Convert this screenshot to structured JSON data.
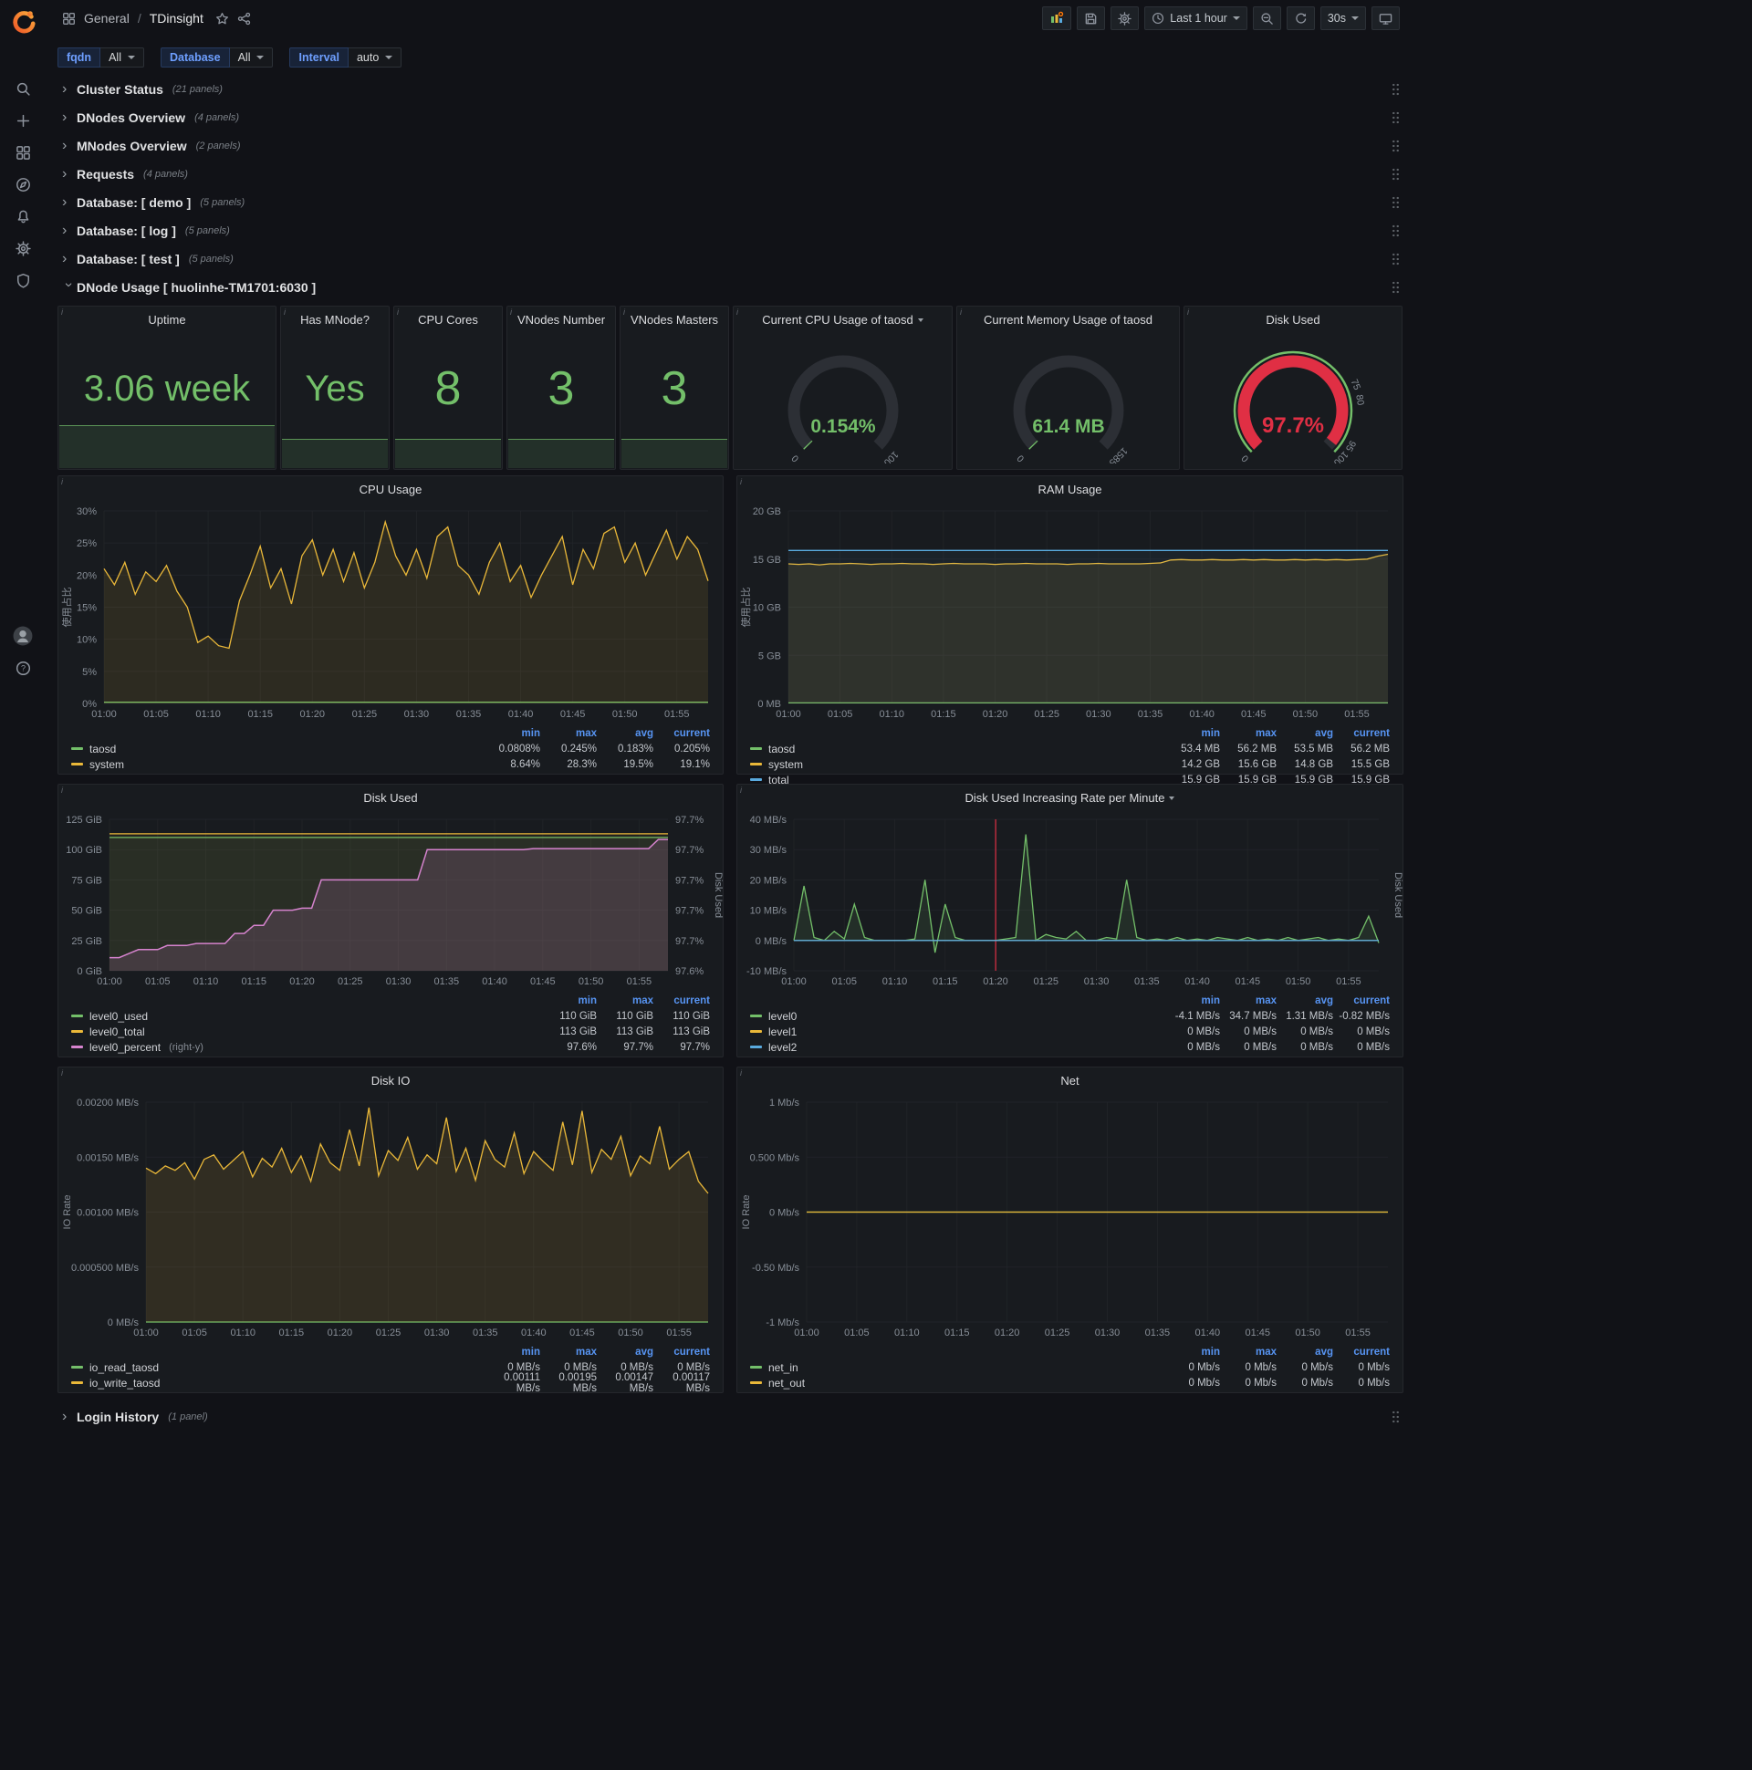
{
  "colors": {
    "green": "#73bf69",
    "yellow": "#eab839",
    "blue": "#59aade",
    "pink": "#d683ce",
    "red": "#e02f44"
  },
  "topbar": {
    "breadcrumb": {
      "section": "General",
      "separator": "/",
      "title": "TDinsight"
    },
    "time_range": "Last 1 hour",
    "refresh": "30s"
  },
  "variables": [
    {
      "label": "fqdn",
      "value": "All"
    },
    {
      "label": "Database",
      "value": "All"
    },
    {
      "label": "Interval",
      "value": "auto"
    }
  ],
  "collapsed_rows": [
    {
      "title": "Cluster Status",
      "count": "(21 panels)"
    },
    {
      "title": "DNodes Overview",
      "count": "(4 panels)"
    },
    {
      "title": "MNodes Overview",
      "count": "(2 panels)"
    },
    {
      "title": "Requests",
      "count": "(4 panels)"
    },
    {
      "title": "Database: [ demo ]",
      "count": "(5 panels)"
    },
    {
      "title": "Database: [ log ]",
      "count": "(5 panels)"
    },
    {
      "title": "Database: [ test ]",
      "count": "(5 panels)"
    }
  ],
  "expanded_row": {
    "title": "DNode Usage [ huolinhe-TM1701:6030 ]"
  },
  "bottom_row": {
    "title": "Login History",
    "count": "(1 panel)"
  },
  "stats": [
    {
      "title": "Uptime",
      "value": "3.06 week"
    },
    {
      "title": "Has MNode?",
      "value": "Yes"
    },
    {
      "title": "CPU Cores",
      "value": "8"
    },
    {
      "title": "VNodes Number",
      "value": "3"
    },
    {
      "title": "VNodes Masters",
      "value": "3"
    }
  ],
  "gauges": [
    {
      "title": "Current CPU Usage of taosd",
      "value": "0.154%",
      "fraction": 0.0025,
      "value_color": "#73bf69",
      "arc_color": "#73bf69",
      "min_label": "0",
      "max_label": "100"
    },
    {
      "title": "Current Memory Usage of taosd",
      "value": "61.4 MB",
      "fraction": 0.004,
      "value_color": "#73bf69",
      "arc_color": "#73bf69",
      "min_label": "0",
      "max_label": "15854"
    },
    {
      "title": "Disk Used",
      "value": "97.7%",
      "fraction": 0.977,
      "value_color": "#e02f44",
      "arc_color": "#e02f44",
      "min_label": "0",
      "threshold_labels": [
        75,
        80,
        95,
        100
      ],
      "outline_color": "#73bf69"
    }
  ],
  "chart_data": [
    {
      "id": "cpu_usage",
      "type": "line",
      "title": "CPU Usage",
      "ylabel": "使用占比",
      "y_min": 0,
      "y_max": 30,
      "y_ticks": [
        {
          "v": 0,
          "label": "0%"
        },
        {
          "v": 5,
          "label": "5%"
        },
        {
          "v": 10,
          "label": "10%"
        },
        {
          "v": 15,
          "label": "15%"
        },
        {
          "v": 20,
          "label": "20%"
        },
        {
          "v": 25,
          "label": "25%"
        },
        {
          "v": 30,
          "label": "30%"
        }
      ],
      "x_minutes": 58,
      "x_tick_every": 5,
      "x_ticks": [
        "01:00",
        "01:05",
        "01:10",
        "01:15",
        "01:20",
        "01:25",
        "01:30",
        "01:35",
        "01:40",
        "01:45",
        "01:50",
        "01:55"
      ],
      "series": [
        {
          "name": "taosd",
          "color": "#73bf69",
          "flat": 0.2,
          "fill": 0.1
        },
        {
          "name": "system",
          "color": "#eab839",
          "fill": 0.1,
          "values": [
            21,
            18.5,
            22,
            17,
            20.5,
            19,
            21.5,
            17.5,
            15,
            9.5,
            10.5,
            9,
            8.6,
            16,
            20,
            24.5,
            18,
            21,
            15.5,
            23,
            25.5,
            20,
            24,
            19,
            23.5,
            18,
            22,
            28.3,
            23,
            20,
            24,
            19.5,
            26,
            27.5,
            21.5,
            20,
            17,
            22,
            25,
            19,
            21.5,
            16.5,
            20,
            23,
            26,
            18.5,
            24,
            21,
            26.5,
            27.5,
            22,
            25,
            20,
            23.5,
            27,
            22.5,
            26,
            24,
            19.1
          ]
        }
      ],
      "legend": {
        "columns": [
          "min",
          "max",
          "avg",
          "current"
        ],
        "rows": [
          {
            "name": "taosd",
            "color": "#73bf69",
            "values": [
              "0.0808%",
              "0.245%",
              "0.183%",
              "0.205%"
            ]
          },
          {
            "name": "system",
            "color": "#eab839",
            "values": [
              "8.64%",
              "28.3%",
              "19.5%",
              "19.1%"
            ]
          }
        ]
      }
    },
    {
      "id": "ram_usage",
      "type": "line",
      "title": "RAM Usage",
      "ylabel": "使用占比",
      "y_min": 0,
      "y_max": 20,
      "y_ticks": [
        {
          "v": 0,
          "label": "0 MB"
        },
        {
          "v": 5,
          "label": "5 GB"
        },
        {
          "v": 10,
          "label": "10 GB"
        },
        {
          "v": 15,
          "label": "15 GB"
        },
        {
          "v": 20,
          "label": "20 GB"
        }
      ],
      "x_minutes": 58,
      "x_tick_every": 5,
      "x_ticks": [
        "01:00",
        "01:05",
        "01:10",
        "01:15",
        "01:20",
        "01:25",
        "01:30",
        "01:35",
        "01:40",
        "01:45",
        "01:50",
        "01:55"
      ],
      "series": [
        {
          "name": "taosd",
          "color": "#73bf69",
          "flat": 0.055,
          "fill": 0.1
        },
        {
          "name": "system",
          "color": "#eab839",
          "fill": 0.1,
          "values": [
            14.5,
            14.45,
            14.5,
            14.4,
            14.5,
            14.5,
            14.55,
            14.5,
            14.45,
            14.5,
            14.5,
            14.55,
            14.5,
            14.5,
            14.45,
            14.5,
            14.55,
            14.5,
            14.5,
            14.5,
            14.45,
            14.5,
            14.5,
            14.55,
            14.5,
            14.5,
            14.5,
            14.45,
            14.5,
            14.5,
            14.55,
            14.5,
            14.5,
            14.5,
            14.5,
            14.55,
            14.6,
            14.9,
            14.95,
            14.9,
            14.9,
            14.95,
            14.9,
            14.9,
            14.95,
            14.9,
            14.95,
            14.9,
            14.9,
            14.95,
            14.9,
            14.95,
            14.9,
            14.95,
            14.9,
            14.95,
            15.0,
            15.3,
            15.5
          ]
        },
        {
          "name": "total",
          "color": "#59aade",
          "flat": 15.9,
          "fill": 0.06
        }
      ],
      "legend": {
        "columns": [
          "min",
          "max",
          "avg",
          "current"
        ],
        "rows": [
          {
            "name": "taosd",
            "color": "#73bf69",
            "values": [
              "53.4 MB",
              "56.2 MB",
              "53.5 MB",
              "56.2 MB"
            ]
          },
          {
            "name": "system",
            "color": "#eab839",
            "values": [
              "14.2 GB",
              "15.6 GB",
              "14.8 GB",
              "15.5 GB"
            ]
          },
          {
            "name": "total",
            "color": "#59aade",
            "values": [
              "15.9 GB",
              "15.9 GB",
              "15.9 GB",
              "15.9 GB"
            ]
          }
        ]
      }
    },
    {
      "id": "disk_used",
      "type": "line",
      "title": "Disk Used",
      "y_min": 0,
      "y_max": 125,
      "y_ticks": [
        {
          "v": 0,
          "label": "0 GiB"
        },
        {
          "v": 25,
          "label": "25 GiB"
        },
        {
          "v": 50,
          "label": "50 GiB"
        },
        {
          "v": 75,
          "label": "75 GiB"
        },
        {
          "v": 100,
          "label": "100 GiB"
        },
        {
          "v": 125,
          "label": "125 GiB"
        }
      ],
      "right_min": 97.575,
      "right_max": 97.725,
      "right_label": "Disk Used",
      "right_ticks": [
        {
          "v": 97.575,
          "label": "97.6%"
        },
        {
          "v": 97.605,
          "label": "97.7%"
        },
        {
          "v": 97.635,
          "label": "97.7%"
        },
        {
          "v": 97.665,
          "label": "97.7%"
        },
        {
          "v": 97.695,
          "label": "97.7%"
        },
        {
          "v": 97.725,
          "label": "97.7%"
        }
      ],
      "x_minutes": 58,
      "x_tick_every": 5,
      "x_ticks": [
        "01:00",
        "01:05",
        "01:10",
        "01:15",
        "01:20",
        "01:25",
        "01:30",
        "01:35",
        "01:40",
        "01:45",
        "01:50",
        "01:55"
      ],
      "series": [
        {
          "name": "level0_used",
          "color": "#73bf69",
          "flat": 110,
          "fill": 0.08
        },
        {
          "name": "level0_total",
          "color": "#eab839",
          "flat": 113,
          "fill": 0.05
        },
        {
          "name": "level0_percent",
          "color": "#d683ce",
          "axis": "right",
          "fill": 0.16,
          "width": 1.5,
          "values": [
            97.588,
            97.588,
            97.592,
            97.596,
            97.596,
            97.596,
            97.6,
            97.6,
            97.6,
            97.602,
            97.602,
            97.602,
            97.602,
            97.612,
            97.612,
            97.62,
            97.62,
            97.635,
            97.635,
            97.635,
            97.637,
            97.637,
            97.665,
            97.665,
            97.665,
            97.665,
            97.665,
            97.665,
            97.665,
            97.665,
            97.665,
            97.665,
            97.665,
            97.695,
            97.695,
            97.695,
            97.695,
            97.695,
            97.695,
            97.695,
            97.695,
            97.695,
            97.695,
            97.695,
            97.696,
            97.696,
            97.696,
            97.696,
            97.696,
            97.696,
            97.696,
            97.696,
            97.696,
            97.696,
            97.696,
            97.696,
            97.696,
            97.705,
            97.705
          ]
        }
      ],
      "legend": {
        "columns": [
          "min",
          "max",
          "current"
        ],
        "rows": [
          {
            "name": "level0_used",
            "color": "#73bf69",
            "values": [
              "110 GiB",
              "110 GiB",
              "110 GiB"
            ]
          },
          {
            "name": "level0_total",
            "color": "#eab839",
            "values": [
              "113 GiB",
              "113 GiB",
              "113 GiB"
            ]
          },
          {
            "name": "level0_percent",
            "suffix": "(right-y)",
            "color": "#d683ce",
            "values": [
              "97.6%",
              "97.7%",
              "97.7%"
            ]
          }
        ]
      }
    },
    {
      "id": "disk_rate",
      "type": "line",
      "title": "Disk Used Increasing Rate per Minute",
      "y_min": -10,
      "y_max": 40,
      "y_ticks": [
        {
          "v": -10,
          "label": "-10 MB/s"
        },
        {
          "v": 0,
          "label": "0 MB/s"
        },
        {
          "v": 10,
          "label": "10 MB/s"
        },
        {
          "v": 20,
          "label": "20 MB/s"
        },
        {
          "v": 30,
          "label": "30 MB/s"
        },
        {
          "v": 40,
          "label": "40 MB/s"
        }
      ],
      "right_label": "Disk Used",
      "annotation_f": 0.345,
      "x_minutes": 58,
      "x_tick_every": 5,
      "x_ticks": [
        "01:00",
        "01:05",
        "01:10",
        "01:15",
        "01:20",
        "01:25",
        "01:30",
        "01:35",
        "01:40",
        "01:45",
        "01:50",
        "01:55"
      ],
      "series": [
        {
          "name": "level0",
          "color": "#73bf69",
          "fill": 0.12,
          "values": [
            0,
            18,
            1,
            0,
            3,
            0.5,
            12,
            1,
            0,
            0,
            0,
            0,
            0.5,
            20,
            -4,
            12,
            1,
            0,
            0,
            0,
            0,
            0.5,
            1,
            35,
            0,
            2,
            1,
            0.5,
            3,
            0,
            0,
            1,
            0.5,
            20,
            1,
            0,
            0.5,
            0,
            1,
            0,
            0.5,
            0,
            1,
            0.5,
            0,
            1,
            0,
            0.5,
            0,
            1,
            0,
            0.5,
            1,
            0,
            0.5,
            0,
            1,
            8,
            -0.8
          ]
        },
        {
          "name": "level1",
          "color": "#eab839",
          "flat": 0
        },
        {
          "name": "level2",
          "color": "#59aade",
          "flat": 0
        }
      ],
      "legend": {
        "columns": [
          "min",
          "max",
          "avg",
          "current"
        ],
        "rows": [
          {
            "name": "level0",
            "color": "#73bf69",
            "values": [
              "-4.1 MB/s",
              "34.7 MB/s",
              "1.31 MB/s",
              "-0.82 MB/s"
            ]
          },
          {
            "name": "level1",
            "color": "#eab839",
            "values": [
              "0 MB/s",
              "0 MB/s",
              "0 MB/s",
              "0 MB/s"
            ]
          },
          {
            "name": "level2",
            "color": "#59aade",
            "values": [
              "0 MB/s",
              "0 MB/s",
              "0 MB/s",
              "0 MB/s"
            ]
          }
        ]
      }
    },
    {
      "id": "disk_io",
      "type": "line",
      "title": "Disk IO",
      "ylabel": "IO Rate",
      "y_min": 0,
      "y_max": 0.002,
      "y_ticks": [
        {
          "v": 0,
          "label": "0 MB/s"
        },
        {
          "v": 0.0005,
          "label": "0.000500 MB/s"
        },
        {
          "v": 0.001,
          "label": "0.00100 MB/s"
        },
        {
          "v": 0.0015,
          "label": "0.00150 MB/s"
        },
        {
          "v": 0.002,
          "label": "0.00200 MB/s"
        }
      ],
      "x_minutes": 58,
      "x_tick_every": 5,
      "x_ticks": [
        "01:00",
        "01:05",
        "01:10",
        "01:15",
        "01:20",
        "01:25",
        "01:30",
        "01:35",
        "01:40",
        "01:45",
        "01:50",
        "01:55"
      ],
      "series": [
        {
          "name": "io_read_taosd",
          "color": "#73bf69",
          "flat": 0,
          "fill": 0.1
        },
        {
          "name": "io_write_taosd",
          "color": "#eab839",
          "fill": 0.12,
          "values": [
            0.0014,
            0.00135,
            0.00142,
            0.00138,
            0.00145,
            0.0013,
            0.00148,
            0.00152,
            0.00139,
            0.00147,
            0.00155,
            0.00132,
            0.00149,
            0.00141,
            0.00158,
            0.00136,
            0.00151,
            0.00128,
            0.00162,
            0.00145,
            0.00138,
            0.00175,
            0.00142,
            0.00195,
            0.00133,
            0.00156,
            0.00147,
            0.00168,
            0.00139,
            0.00152,
            0.00144,
            0.00186,
            0.00137,
            0.00158,
            0.00129,
            0.00165,
            0.00148,
            0.00141,
            0.00172,
            0.00135,
            0.00155,
            0.00146,
            0.00138,
            0.00182,
            0.00143,
            0.00192,
            0.00136,
            0.00157,
            0.00148,
            0.00169,
            0.00133,
            0.00151,
            0.00144,
            0.00178,
            0.00139,
            0.00148,
            0.00155,
            0.00128,
            0.00117
          ]
        }
      ],
      "legend": {
        "columns": [
          "min",
          "max",
          "avg",
          "current"
        ],
        "rows": [
          {
            "name": "io_read_taosd",
            "color": "#73bf69",
            "values": [
              "0 MB/s",
              "0 MB/s",
              "0 MB/s",
              "0 MB/s"
            ]
          },
          {
            "name": "io_write_taosd",
            "color": "#eab839",
            "values": [
              "0.00111 MB/s",
              "0.00195 MB/s",
              "0.00147 MB/s",
              "0.00117 MB/s"
            ]
          }
        ]
      }
    },
    {
      "id": "net",
      "type": "line",
      "title": "Net",
      "ylabel": "IO Rate",
      "y_min": -1,
      "y_max": 1,
      "y_ticks": [
        {
          "v": -1,
          "label": "-1 Mb/s"
        },
        {
          "v": -0.5,
          "label": "-0.50 Mb/s"
        },
        {
          "v": 0,
          "label": "0 Mb/s"
        },
        {
          "v": 0.5,
          "label": "0.500 Mb/s"
        },
        {
          "v": 1,
          "label": "1 Mb/s"
        }
      ],
      "x_minutes": 58,
      "x_tick_every": 5,
      "x_ticks": [
        "01:00",
        "01:05",
        "01:10",
        "01:15",
        "01:20",
        "01:25",
        "01:30",
        "01:35",
        "01:40",
        "01:45",
        "01:50",
        "01:55"
      ],
      "series": [
        {
          "name": "net_in",
          "color": "#73bf69",
          "flat": 0
        },
        {
          "name": "net_out",
          "color": "#eab839",
          "flat": 0
        }
      ],
      "legend": {
        "columns": [
          "min",
          "max",
          "avg",
          "current"
        ],
        "rows": [
          {
            "name": "net_in",
            "color": "#73bf69",
            "values": [
              "0 Mb/s",
              "0 Mb/s",
              "0 Mb/s",
              "0 Mb/s"
            ]
          },
          {
            "name": "net_out",
            "color": "#eab839",
            "values": [
              "0 Mb/s",
              "0 Mb/s",
              "0 Mb/s",
              "0 Mb/s"
            ]
          }
        ]
      }
    }
  ]
}
